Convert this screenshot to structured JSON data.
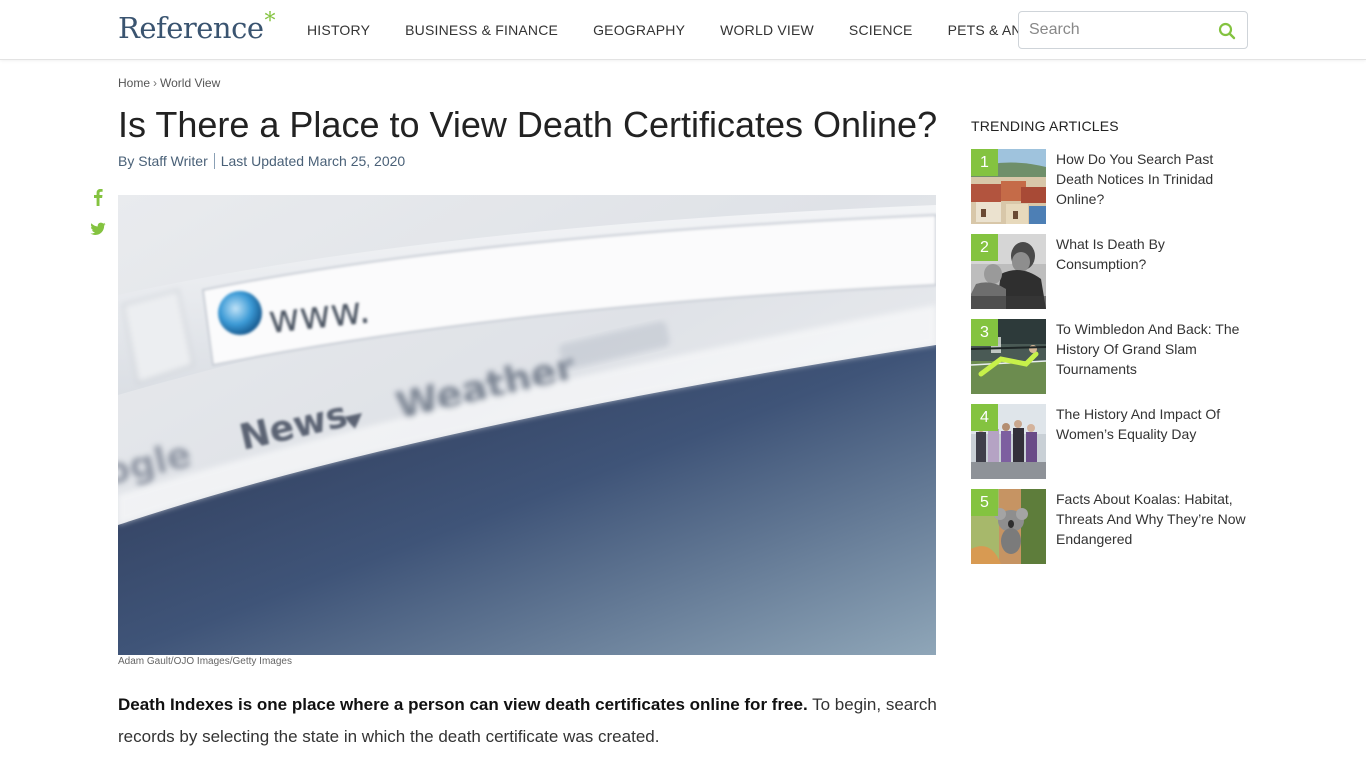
{
  "header": {
    "logo_text": "Reference",
    "logo_star": "*",
    "nav": [
      "HISTORY",
      "BUSINESS & FINANCE",
      "GEOGRAPHY",
      "WORLD VIEW",
      "SCIENCE",
      "PETS & ANIMALS"
    ],
    "search_placeholder": "Search",
    "search_icon": "search-icon"
  },
  "breadcrumb": {
    "home": "Home",
    "separator": "›",
    "current": "World View"
  },
  "article": {
    "title": "Is There a Place to View Death Certificates Online?",
    "author": "By Staff Writer",
    "updated": "Last Updated March 25, 2020",
    "image_credit": "Adam Gault/OJO Images/Getty Images",
    "hero_text": {
      "www": "www.",
      "news": "News",
      "weather": "Weather",
      "google": "ogle"
    },
    "lead_bold": "Death Indexes is one place where a person can view death certificates online for free.",
    "lead_rest": " To begin, search records by selecting the state in which the death certificate was created."
  },
  "social": {
    "facebook_icon": "facebook-icon",
    "twitter_icon": "twitter-icon"
  },
  "sidebar": {
    "title": "TRENDING ARTICLES",
    "items": [
      {
        "num": "1",
        "text": "How Do You Search Past Death Notices In Trinidad Online?"
      },
      {
        "num": "2",
        "text": "What Is Death By Consumption?"
      },
      {
        "num": "3",
        "text": "To Wimbledon And Back: The History Of Grand Slam Tournaments"
      },
      {
        "num": "4",
        "text": "The History And Impact Of Women’s Equality Day"
      },
      {
        "num": "5",
        "text": "Facts About Koalas: Habitat, Threats And Why They’re Now Endangered"
      }
    ]
  },
  "colors": {
    "accent": "#84c340",
    "logo": "#3a5470",
    "byline": "#4a6178"
  }
}
